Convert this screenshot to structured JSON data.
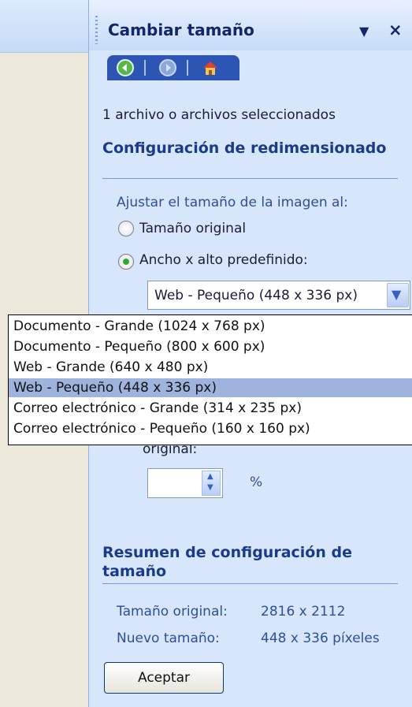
{
  "pane": {
    "title": "Cambiar tamaño",
    "menu_glyph": "▼",
    "close_glyph": "×",
    "nav": {
      "back_icon": "back-arrow-icon",
      "forward_icon": "forward-arrow-icon",
      "home_icon": "home-icon"
    }
  },
  "files_selected": "1 archivo o archivos seleccionados",
  "resize_section": {
    "heading": "Configuración de redimensionado",
    "adjust_label": "Ajustar el tamaño de la imagen al:",
    "radio_original": "Tamaño original",
    "radio_preset": "Ancho x alto predefinido:",
    "selected_radio": "preset"
  },
  "combo": {
    "value": "Web - Pequeño (448 x 336 px)",
    "options": [
      "Documento - Grande (1024 x 768 px)",
      "Documento - Pequeño (800 x 600 px)",
      "Web - Grande (640 x 480 px)",
      "Web - Pequeño (448 x 336 px)",
      "Correo electrónico - Grande (314 x 235 px)",
      "Correo electrónico - Pequeño (160 x 160 px)"
    ],
    "selected_index": 3
  },
  "percent": {
    "partial_label": "original:",
    "value": "",
    "unit": "%"
  },
  "summary_section": {
    "heading": "Resumen de configuración de tamaño",
    "original_label": "Tamaño original:",
    "original_value": "2816 x 2112",
    "new_label": "Nuevo tamaño:",
    "new_value": "448 x 336 píxeles"
  },
  "accept_label": "Aceptar",
  "colors": {
    "pane_bg": "#d8e6fb",
    "heading": "#1a3a8a",
    "nav_bar": "#2d56b4",
    "selected_option": "#9eb4de"
  }
}
